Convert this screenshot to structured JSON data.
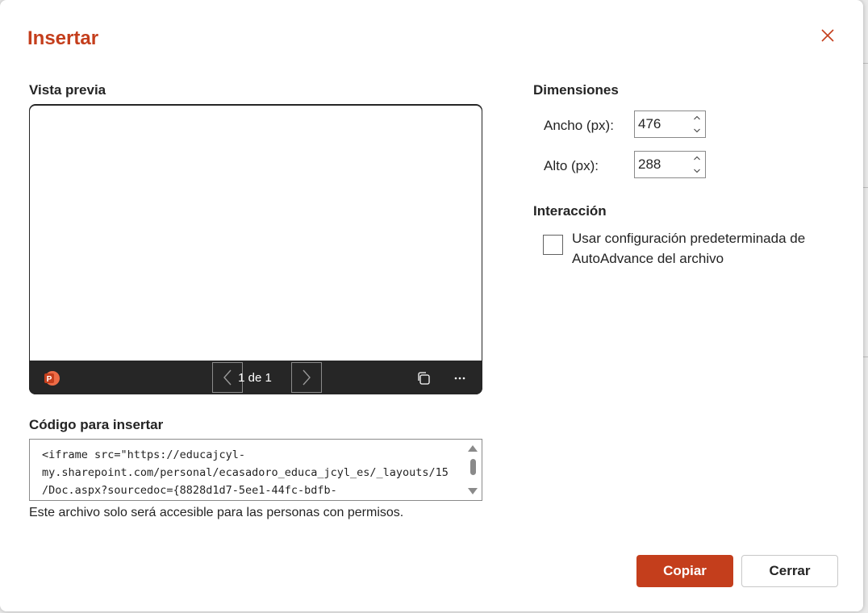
{
  "dialog": {
    "title": "Insertar",
    "accent_color": "#c43e1c"
  },
  "preview": {
    "label": "Vista previa",
    "page_indicator": "1 de 1",
    "app_icon": "powerpoint-icon"
  },
  "embed": {
    "label": "Código para insertar",
    "code": "<iframe src=\"https://educajcyl-\nmy.sharepoint.com/personal/ecasadoro_educa_jcyl_es/_layouts/15\n/Doc.aspx?sourcedoc={8828d1d7-5ee1-44fc-bdfb-",
    "note": "Este archivo solo será accesible para las personas con permisos."
  },
  "dimensions": {
    "label": "Dimensiones",
    "width_label": "Ancho (px):",
    "width_value": "476",
    "height_label": "Alto (px):",
    "height_value": "288"
  },
  "interaction": {
    "label": "Interacción",
    "checkbox_label": "Usar configuración predeterminada de AutoAdvance del archivo",
    "checked": false
  },
  "buttons": {
    "copy": "Copiar",
    "close": "Cerrar"
  }
}
